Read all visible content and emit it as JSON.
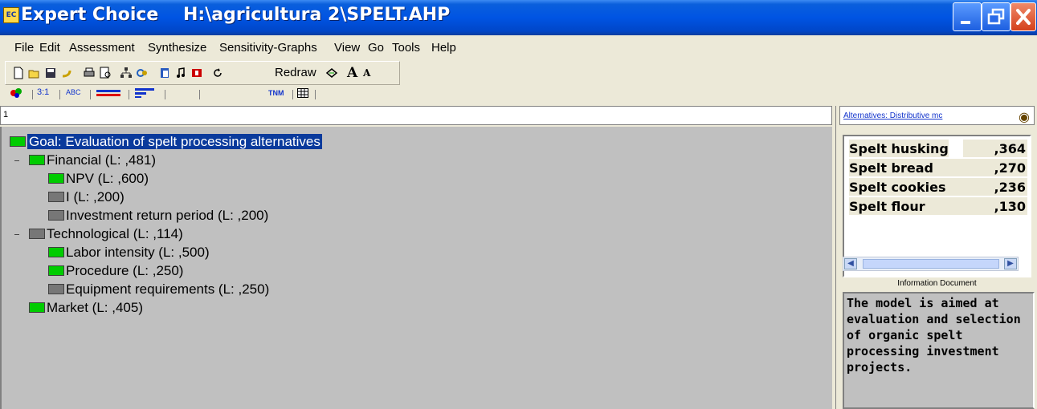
{
  "window": {
    "app_name": "Expert Choice",
    "file_path": "H:\\agricultura 2\\SPELT.AHP",
    "app_icon_text": "EC"
  },
  "menu": [
    "File",
    "Edit",
    "Assessment",
    "Synthesize",
    "Sensitivity-Graphs",
    "View",
    "Go",
    "Tools",
    "Help"
  ],
  "toolbar": {
    "redraw_label": "Redraw",
    "font_larger": "A",
    "font_smaller": "A",
    "icons": [
      "new-icon",
      "open-icon",
      "save-icon",
      "undo-icon",
      "print-icon",
      "preview-icon",
      "tree-icon",
      "link-icon",
      "paste-icon",
      "music-icon",
      "info-icon"
    ]
  },
  "toolbar2": {
    "items": [
      "3:1",
      "ABC",
      "",
      "",
      "TNM",
      ""
    ],
    "icon_names": [
      "pie-chart-icon",
      "numerical-compare-icon",
      "verbal-compare-icon",
      "graphical-compare-icon",
      "questionnaire-icon",
      "ratings-icon",
      "grid-icon"
    ]
  },
  "ruler": {
    "label": "1"
  },
  "tree": {
    "goal": "Goal: Evaluation of spelt processing alternatives",
    "nodes": [
      {
        "label": "Financial (L: ,481)",
        "level": 1,
        "color": "green",
        "expanded": true
      },
      {
        "label": "NPV (L: ,600)",
        "level": 2,
        "color": "green"
      },
      {
        "label": "I (L: ,200)",
        "level": 2,
        "color": "gray"
      },
      {
        "label": "Investment return period (L: ,200)",
        "level": 2,
        "color": "gray"
      },
      {
        "label": "Technological (L: ,114)",
        "level": 1,
        "color": "gray",
        "expanded": true
      },
      {
        "label": "Labor intensity (L: ,500)",
        "level": 2,
        "color": "green"
      },
      {
        "label": "Procedure (L: ,250)",
        "level": 2,
        "color": "green"
      },
      {
        "label": "Equipment requirements (L: ,250)",
        "level": 2,
        "color": "gray"
      },
      {
        "label": "Market (L: ,405)",
        "level": 1,
        "color": "green"
      }
    ]
  },
  "colors": {
    "selected_bg": "#0a3a9c",
    "node_green": "#00cc00",
    "node_gray": "#777777",
    "tree_bg": "#c0c0c0"
  },
  "right_panel": {
    "header_link": "Alternatives: Distributive mc",
    "finder_icon": "binoculars-icon",
    "alternatives": [
      {
        "name": "Spelt husking",
        "value": ",364",
        "bar": 0.364
      },
      {
        "name": "Spelt bread",
        "value": ",270"
      },
      {
        "name": "Spelt cookies",
        "value": ",236"
      },
      {
        "name": "Spelt flour",
        "value": ",130"
      }
    ],
    "info_title": "Information Document",
    "info_text": "The model is aimed at evaluation and selection of organic spelt processing investment projects."
  }
}
